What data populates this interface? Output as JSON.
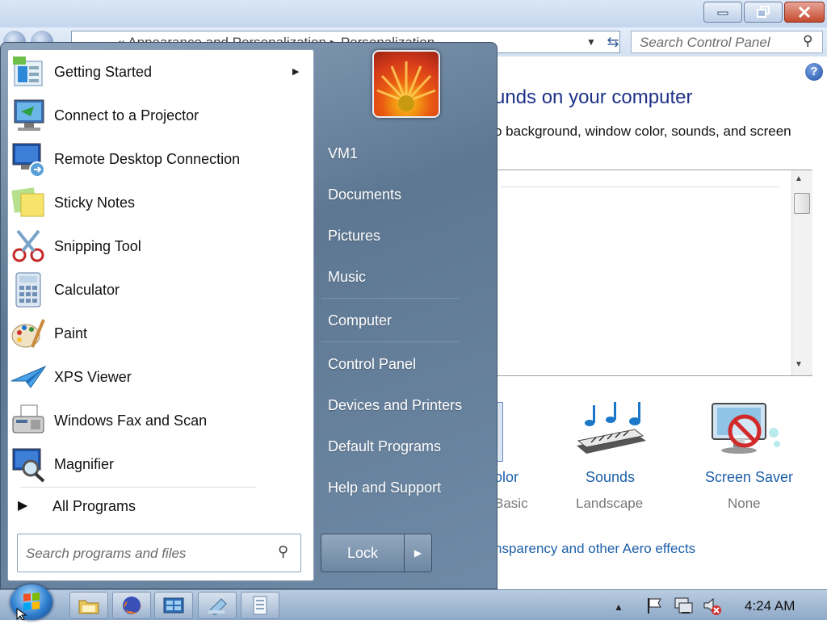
{
  "window": {
    "address_path": "«  Appearance and Personalization  ▸  Personalization",
    "search_placeholder": "Search Control Panel",
    "help": "?",
    "heading": "unds on your computer",
    "subheading": "o background, window color, sounds, and screen",
    "tiles": [
      {
        "label": "olor",
        "value": "Basic",
        "icon": "window-color-icon"
      },
      {
        "label": "Sounds",
        "value": "Landscape",
        "icon": "sounds-icon"
      },
      {
        "label": "Screen Saver",
        "value": "None",
        "icon": "screen-saver-icon"
      }
    ],
    "aero_link": "nsparency and other Aero effects"
  },
  "start_menu": {
    "programs": [
      {
        "label": "Getting Started",
        "icon": "getting-started-icon",
        "has_submenu": true
      },
      {
        "label": "Connect to a Projector",
        "icon": "projector-icon"
      },
      {
        "label": "Remote Desktop Connection",
        "icon": "remote-desktop-icon"
      },
      {
        "label": "Sticky Notes",
        "icon": "sticky-notes-icon"
      },
      {
        "label": "Snipping Tool",
        "icon": "snipping-tool-icon"
      },
      {
        "label": "Calculator",
        "icon": "calculator-icon"
      },
      {
        "label": "Paint",
        "icon": "paint-icon"
      },
      {
        "label": "XPS Viewer",
        "icon": "xps-viewer-icon"
      },
      {
        "label": "Windows Fax and Scan",
        "icon": "fax-scan-icon"
      },
      {
        "label": "Magnifier",
        "icon": "magnifier-icon"
      }
    ],
    "all_programs": "All Programs",
    "search_placeholder": "Search programs and files",
    "right_items": [
      "VM1",
      "Documents",
      "Pictures",
      "Music",
      "Computer",
      "Control Panel",
      "Devices and Printers",
      "Default Programs",
      "Help and Support"
    ],
    "lock_label": "Lock"
  },
  "taskbar": {
    "clock": "4:24 AM",
    "pinned": [
      "file-explorer-icon",
      "firefox-icon",
      "control-panel-icon",
      "notepad-icon",
      "document-icon"
    ]
  },
  "colors": {
    "link_blue": "#1d5fa8",
    "heading_blue": "#1e3287",
    "start_menu_slate": "#5d7792"
  }
}
